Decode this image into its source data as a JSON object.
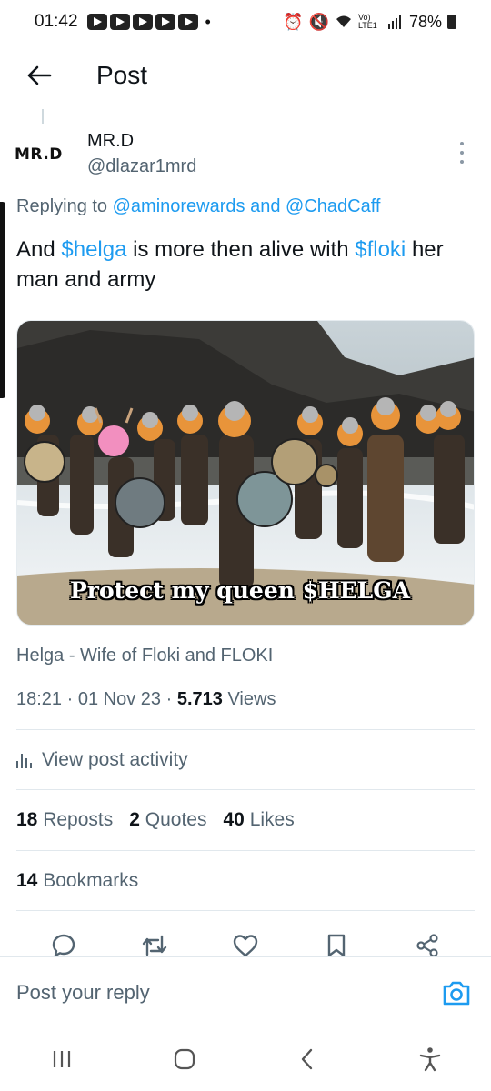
{
  "status_bar": {
    "time": "01:42",
    "battery": "78%",
    "network": "Vo) LTE1"
  },
  "header": {
    "title": "Post"
  },
  "post": {
    "author_name": "MR.D",
    "author_handle": "@dlazar1mrd",
    "avatar_text": "MR.D",
    "replying_prefix": "Replying to",
    "replying_to_1": "@aminorewards",
    "replying_and": "and",
    "replying_to_2": "@ChadCaff",
    "text_part1": "And",
    "text_link1": "$helga",
    "text_part2": "is more then alive with",
    "text_link2": "$floki",
    "text_part3": "her man and army",
    "media_caption": "Protect my queen $HELGA",
    "card_title": "Helga - Wife of Floki and FLOKI",
    "time": "18:21",
    "date": "01 Nov 23",
    "views_count": "5.713",
    "views_label": "Views"
  },
  "activity": {
    "label": "View post activity"
  },
  "stats": {
    "reposts_count": "18",
    "reposts_label": "Reposts",
    "quotes_count": "2",
    "quotes_label": "Quotes",
    "likes_count": "40",
    "likes_label": "Likes",
    "bookmarks_count": "14",
    "bookmarks_label": "Bookmarks"
  },
  "reply": {
    "placeholder": "Post your reply"
  },
  "colors": {
    "link": "#1d9bf0",
    "text_primary": "#0f1419",
    "text_secondary": "#536471",
    "divider": "#e1e8ed"
  },
  "icons": {
    "back": "arrow-left-icon",
    "more": "more-vertical-icon",
    "reply": "comment-icon",
    "repost": "repost-icon",
    "like": "heart-icon",
    "bookmark": "bookmark-icon",
    "share": "share-icon",
    "camera": "camera-icon",
    "activity": "bar-chart-icon"
  }
}
